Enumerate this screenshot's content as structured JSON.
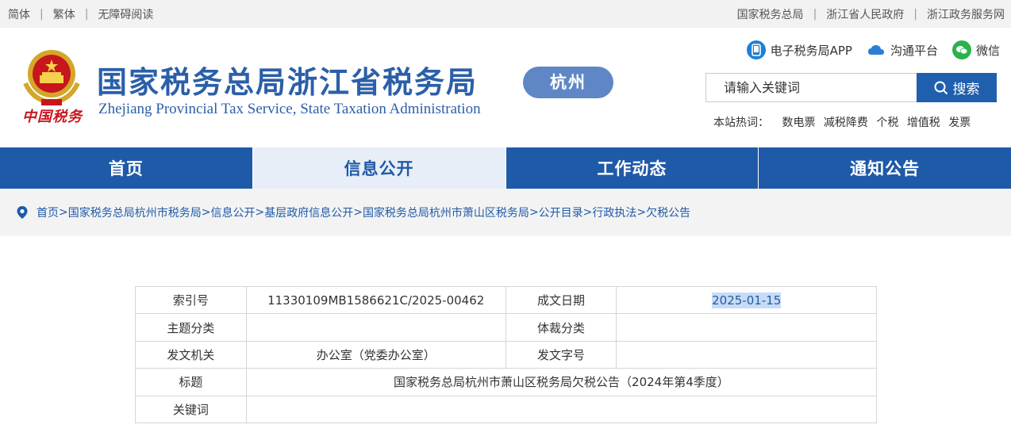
{
  "topbar": {
    "left": [
      "简体",
      "繁体",
      "无障碍阅读"
    ],
    "right": [
      "国家税务总局",
      "浙江省人民政府",
      "浙江政务服务网"
    ]
  },
  "header": {
    "emblem_icon": "national-emblem-icon",
    "seal_text": "中国税务",
    "title_cn": "国家税务总局浙江省税务局",
    "title_en": "Zhejiang Provincial Tax Service, State Taxation Administration",
    "city": "杭州",
    "quick_links": [
      {
        "label": "电子税务局APP",
        "icon": "phone-app-icon",
        "color": "#1f7fd6"
      },
      {
        "label": "沟通平台",
        "icon": "cloud-icon",
        "color": "#2a7fd3"
      },
      {
        "label": "微信",
        "icon": "wechat-icon",
        "color": "#2bb24c"
      }
    ],
    "search": {
      "placeholder": "请输入关键词",
      "button": "搜索"
    },
    "hot": {
      "label": "本站热词：",
      "words": [
        "数电票",
        "减税降费",
        "个税",
        "增值税",
        "发票"
      ]
    }
  },
  "nav": [
    "首页",
    "信息公开",
    "工作动态",
    "通知公告"
  ],
  "nav_active_index": 1,
  "breadcrumb": [
    "首页",
    "国家税务总局杭州市税务局",
    "信息公开",
    "基层政府信息公开",
    "国家税务总局杭州市萧山区税务局",
    "公开目录",
    "行政执法",
    "欠税公告"
  ],
  "info": {
    "index_label": "索引号",
    "index_value": "11330109MB1586621C/2025-00462",
    "date_label": "成文日期",
    "date_value": "2025-01-15",
    "topic_label": "主题分类",
    "topic_value": "",
    "genre_label": "体裁分类",
    "genre_value": "",
    "issuer_label": "发文机关",
    "issuer_value": "办公室（党委办公室）",
    "doc_no_label": "发文字号",
    "doc_no_value": "",
    "title_label": "标题",
    "title_value": "国家税务总局杭州市萧山区税务局欠税公告（2024年第4季度）",
    "keywords_label": "关键词",
    "keywords_value": ""
  },
  "colors": {
    "brand_blue": "#1f5aa8",
    "seal_red": "#c8161d",
    "highlight": "#c8dbf6"
  }
}
